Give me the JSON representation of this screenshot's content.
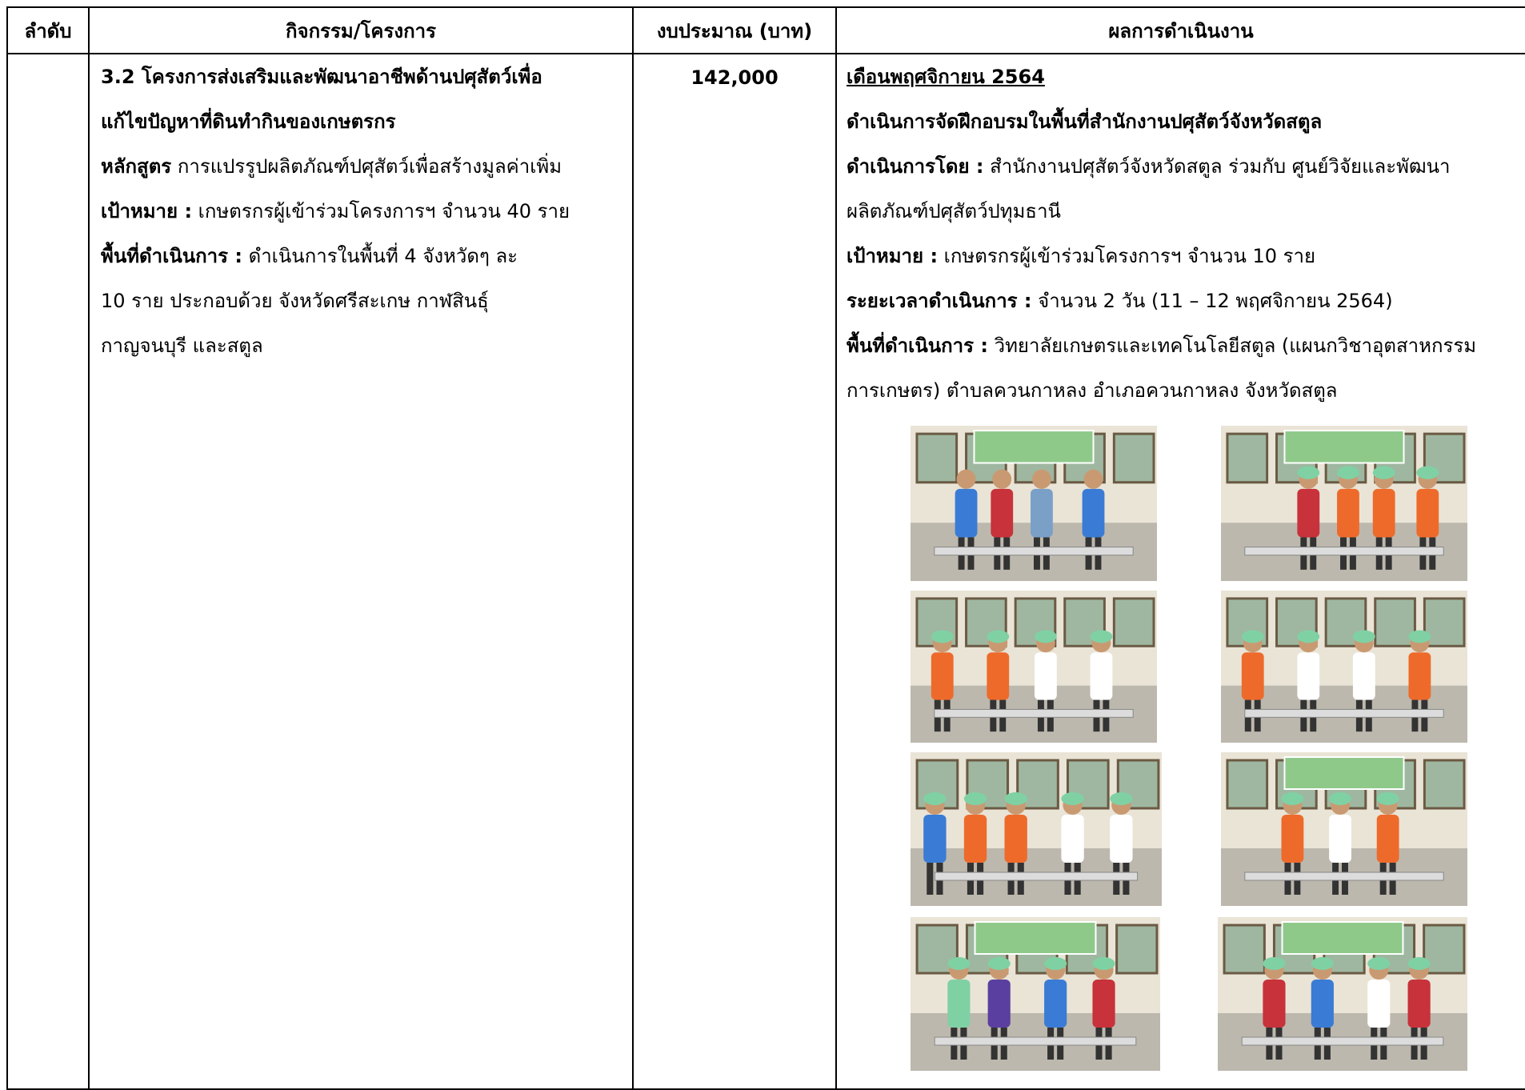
{
  "header": {
    "col_order": "ลำดับ",
    "col_activity": "กิจกรรม/โครงการ",
    "col_budget": "งบประมาณ (บาท)",
    "col_results": "ผลการดำเนินงาน"
  },
  "activity": {
    "title_line1": "3.2 โครงการส่งเสริมและพัฒนาอาชีพด้านปศุสัตว์เพื่อ",
    "title_line2": "แก้ไขปัญหาที่ดินทำกินของเกษตรกร",
    "course_label": "หลักสูตร",
    "course_value": " การแปรรูปผลิตภัณฑ์ปศุสัตว์เพื่อสร้างมูลค่าเพิ่ม",
    "target_label": "เป้าหมาย :",
    "target_value": " เกษตรกรผู้เข้าร่วมโครงการฯ จำนวน 40 ราย",
    "area_label": "พื้นที่ดำเนินการ :",
    "area_value": " ดำเนินการในพื้นที่ 4 จังหวัดๆ ละ",
    "area_line2": "10 ราย ประกอบด้วย จังหวัดศรีสะเกษ กาฬสินธุ์",
    "area_line3": "กาญจนบุรี และสตูล"
  },
  "budget": "142,000",
  "results": {
    "month": "เดือนพฤศจิกายน 2564",
    "headline": "ดำเนินการจัดฝึกอบรมในพื้นที่สำนักงานปศุสัตว์จังหวัดสตูล",
    "by_label": "ดำเนินการโดย :",
    "by_value": " สำนักงานปศุสัตว์จังหวัดสตูล ร่วมกับ ศูนย์วิจัยและพัฒนา",
    "by_line2": "ผลิตภัณฑ์ปศุสัตว์ปทุมธานี",
    "target_label": "เป้าหมาย :",
    "target_value": " เกษตรกรผู้เข้าร่วมโครงการฯ จำนวน 10 ราย",
    "period_label": "ระยะเวลาดำเนินการ :",
    "period_value": " จำนวน 2 วัน (11 – 12 พฤศจิกายน 2564)",
    "area_label": "พื้นที่ดำเนินการ :",
    "area_value": " วิทยาลัยเกษตรและเทคโนโลยีสตูล (แผนกวิชาอุตสาหกรรม",
    "area_line2": "การเกษตร) ตำบลควนกาหลง อำเภอควนกาหลง จังหวัดสตูล"
  },
  "colors": {
    "table_border": "#000000",
    "photo_wall": "#e9e4d6",
    "photo_floor": "#bdb8ad",
    "apron_orange": "#ee6a2b",
    "hairnet_green": "#7fd1a4",
    "banner_green": "#8fc98a",
    "shirt_blue": "#3a7bd5",
    "shirt_red": "#c8323a"
  }
}
